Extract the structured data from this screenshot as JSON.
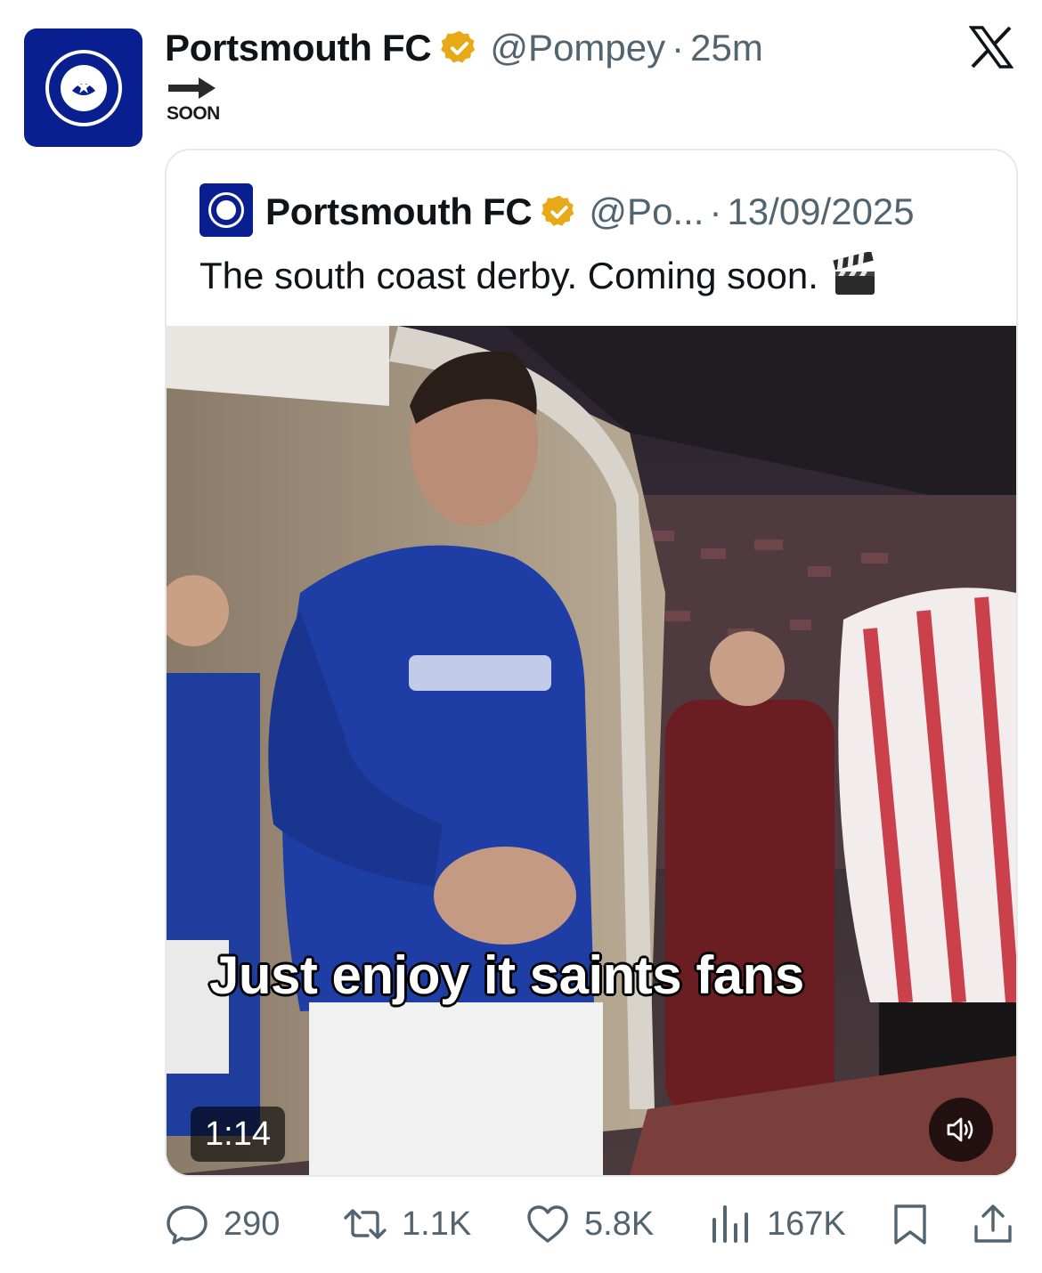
{
  "tweet": {
    "author_name": "Portsmouth FC",
    "handle": "@Pompey",
    "separator": "·",
    "time": "25m",
    "body_label": "SOON",
    "body_arrow_icon": "right-arrow-icon"
  },
  "quoted": {
    "author_name": "Portsmouth FC",
    "handle": "@Po...",
    "separator": "·",
    "date": "13/09/2025",
    "text": "The south coast derby. Coming soon.",
    "emoji_icon": "clapper-board-icon"
  },
  "video": {
    "caption": "Just enjoy it saints fans",
    "duration": "1:14",
    "sound_icon": "speaker-icon"
  },
  "metrics": {
    "replies": "290",
    "reposts": "1.1K",
    "likes": "5.8K",
    "views": "167K"
  },
  "colors": {
    "brand_navy": "#0a1f8f",
    "verified_gold": "#e8a918",
    "muted_text": "#536471"
  }
}
